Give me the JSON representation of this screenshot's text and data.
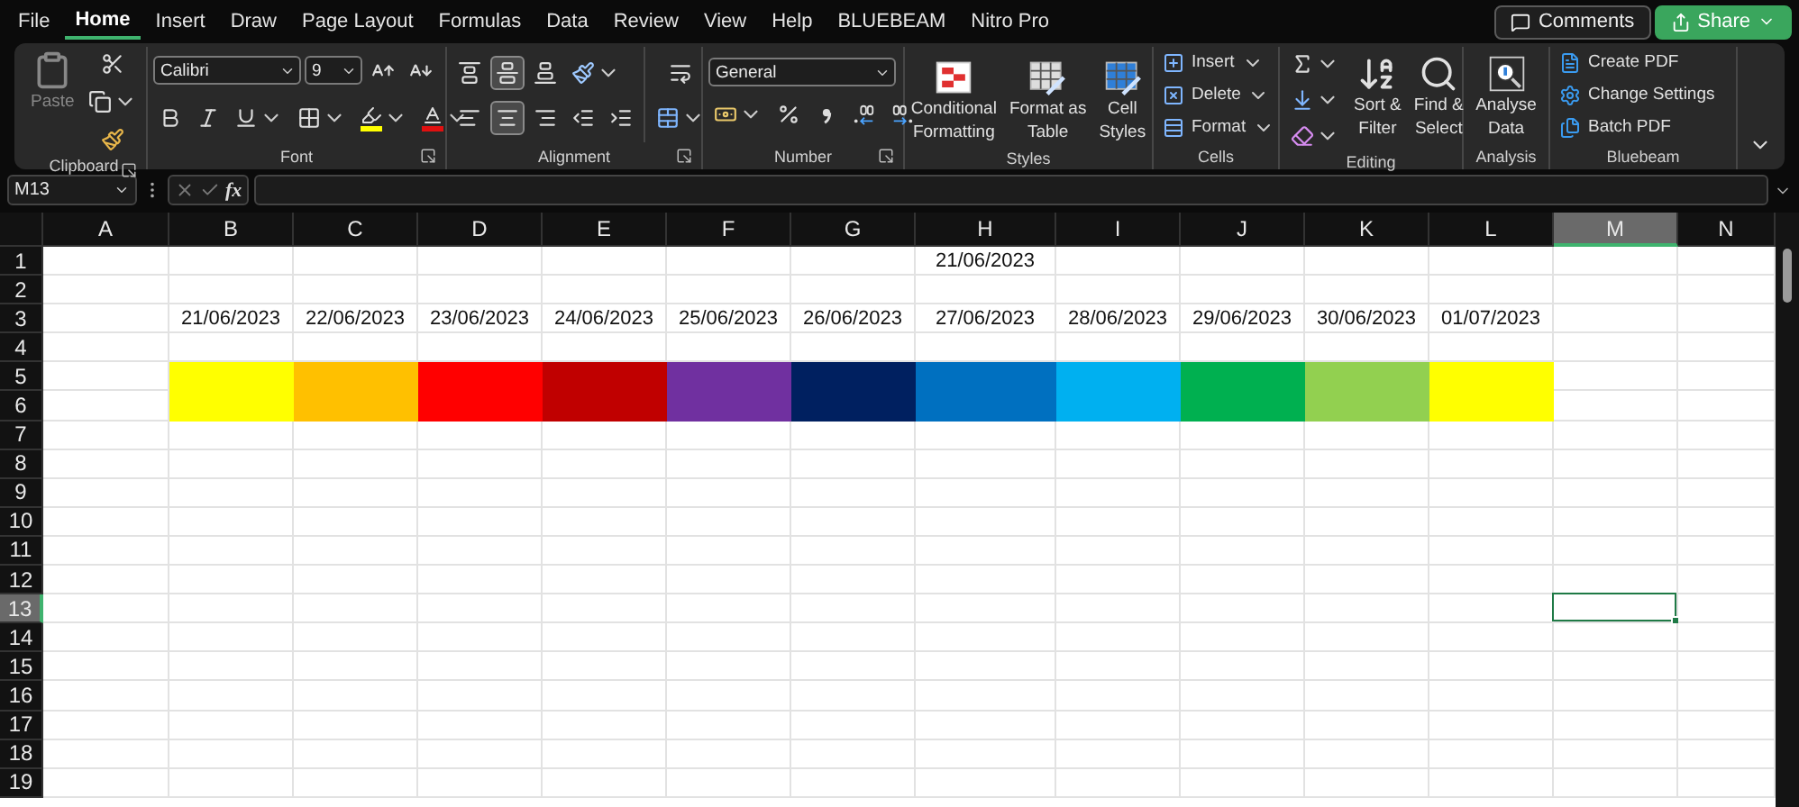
{
  "menu_tabs": [
    {
      "label": "File",
      "selected": false
    },
    {
      "label": "Home",
      "selected": true
    },
    {
      "label": "Insert",
      "selected": false
    },
    {
      "label": "Draw",
      "selected": false
    },
    {
      "label": "Page Layout",
      "selected": false
    },
    {
      "label": "Formulas",
      "selected": false
    },
    {
      "label": "Data",
      "selected": false
    },
    {
      "label": "Review",
      "selected": false
    },
    {
      "label": "View",
      "selected": false
    },
    {
      "label": "Help",
      "selected": false
    },
    {
      "label": "BLUEBEAM",
      "selected": false
    },
    {
      "label": "Nitro Pro",
      "selected": false
    }
  ],
  "comments_button": {
    "label": "Comments"
  },
  "share_button": {
    "label": "Share"
  },
  "ribbon": {
    "clipboard": {
      "title": "Clipboard",
      "paste_label": "Paste"
    },
    "font": {
      "title": "Font",
      "font_name": "Calibri",
      "font_size": "9"
    },
    "alignment": {
      "title": "Alignment",
      "vertical_buttons": [
        {
          "selected": false
        },
        {
          "selected": true
        },
        {
          "selected": false
        }
      ],
      "horizontal_buttons": [
        {
          "selected": false
        },
        {
          "selected": true
        },
        {
          "selected": false
        }
      ]
    },
    "number": {
      "title": "Number",
      "format": "General"
    },
    "styles": {
      "title": "Styles",
      "buttons": [
        {
          "lines": [
            "Conditional",
            "Formatting"
          ]
        },
        {
          "lines": [
            "Format as",
            "Table"
          ]
        },
        {
          "lines": [
            "Cell",
            "Styles"
          ]
        }
      ]
    },
    "cells": {
      "title": "Cells",
      "buttons": [
        "Insert",
        "Delete",
        "Format"
      ]
    },
    "editing": {
      "title": "Editing",
      "buttons": [
        {
          "lines": [
            "Sort &",
            "Filter"
          ]
        },
        {
          "lines": [
            "Find &",
            "Select"
          ]
        }
      ]
    },
    "analysis": {
      "title": "Analysis",
      "buttons": [
        {
          "lines": [
            "Analyse",
            "Data"
          ]
        }
      ]
    },
    "bluebeam": {
      "title": "Bluebeam",
      "buttons": [
        "Create PDF",
        "Change Settings",
        "Batch PDF"
      ]
    }
  },
  "formula_bar": {
    "name_box": "M13",
    "function_label": "fx"
  },
  "sheet": {
    "columns": [
      {
        "label": "A",
        "selected": false
      },
      {
        "label": "B",
        "selected": false
      },
      {
        "label": "C",
        "selected": false
      },
      {
        "label": "D",
        "selected": false
      },
      {
        "label": "E",
        "selected": false
      },
      {
        "label": "F",
        "selected": false
      },
      {
        "label": "G",
        "selected": false
      },
      {
        "label": "H",
        "selected": false
      },
      {
        "label": "I",
        "selected": false
      },
      {
        "label": "J",
        "selected": false
      },
      {
        "label": "K",
        "selected": false
      },
      {
        "label": "L",
        "selected": false
      },
      {
        "label": "M",
        "selected": true
      },
      {
        "label": "N",
        "selected": false
      }
    ],
    "rows": [
      {
        "label": "1",
        "selected": false,
        "cells": [
          null,
          null,
          null,
          null,
          null,
          null,
          null,
          {
            "text": "21/06/2023"
          }
        ]
      },
      {
        "label": "2",
        "selected": false
      },
      {
        "label": "3",
        "selected": false,
        "cells": [
          null,
          {
            "text": "21/06/2023"
          },
          {
            "text": "22/06/2023"
          },
          {
            "text": "23/06/2023"
          },
          {
            "text": "24/06/2023"
          },
          {
            "text": "25/06/2023"
          },
          {
            "text": "26/06/2023"
          },
          {
            "text": "27/06/2023"
          },
          {
            "text": "28/06/2023"
          },
          {
            "text": "29/06/2023"
          },
          {
            "text": "30/06/2023"
          },
          {
            "text": "01/07/2023"
          }
        ]
      },
      {
        "label": "4",
        "selected": false
      },
      {
        "label": "5",
        "selected": false,
        "cells": [
          null,
          {
            "color": "#ffff00"
          },
          {
            "color": "#ffc000"
          },
          {
            "color": "#ff0000"
          },
          {
            "color": "#c00000"
          },
          {
            "color": "#7030a0"
          },
          {
            "color": "#002060"
          },
          {
            "color": "#0070c0"
          },
          {
            "color": "#00b0f0"
          },
          {
            "color": "#00b050"
          },
          {
            "color": "#92d050"
          },
          {
            "color": "#ffff00"
          }
        ]
      },
      {
        "label": "6",
        "selected": false,
        "cells": [
          null,
          {
            "color": "#ffff00"
          },
          {
            "color": "#ffc000"
          },
          {
            "color": "#ff0000"
          },
          {
            "color": "#c00000"
          },
          {
            "color": "#7030a0"
          },
          {
            "color": "#002060"
          },
          {
            "color": "#0070c0"
          },
          {
            "color": "#00b0f0"
          },
          {
            "color": "#00b050"
          },
          {
            "color": "#92d050"
          },
          {
            "color": "#ffff00"
          }
        ]
      },
      {
        "label": "7",
        "selected": false
      },
      {
        "label": "8",
        "selected": false
      },
      {
        "label": "9",
        "selected": false
      },
      {
        "label": "10",
        "selected": false
      },
      {
        "label": "11",
        "selected": false
      },
      {
        "label": "12",
        "selected": false
      },
      {
        "label": "13",
        "selected": true,
        "cells": [
          null,
          null,
          null,
          null,
          null,
          null,
          null,
          null,
          null,
          null,
          null,
          null,
          {
            "active": true
          }
        ]
      },
      {
        "label": "14",
        "selected": false
      },
      {
        "label": "15",
        "selected": false
      },
      {
        "label": "16",
        "selected": false
      },
      {
        "label": "17",
        "selected": false
      },
      {
        "label": "18",
        "selected": false
      },
      {
        "label": "19",
        "selected": false
      }
    ]
  }
}
